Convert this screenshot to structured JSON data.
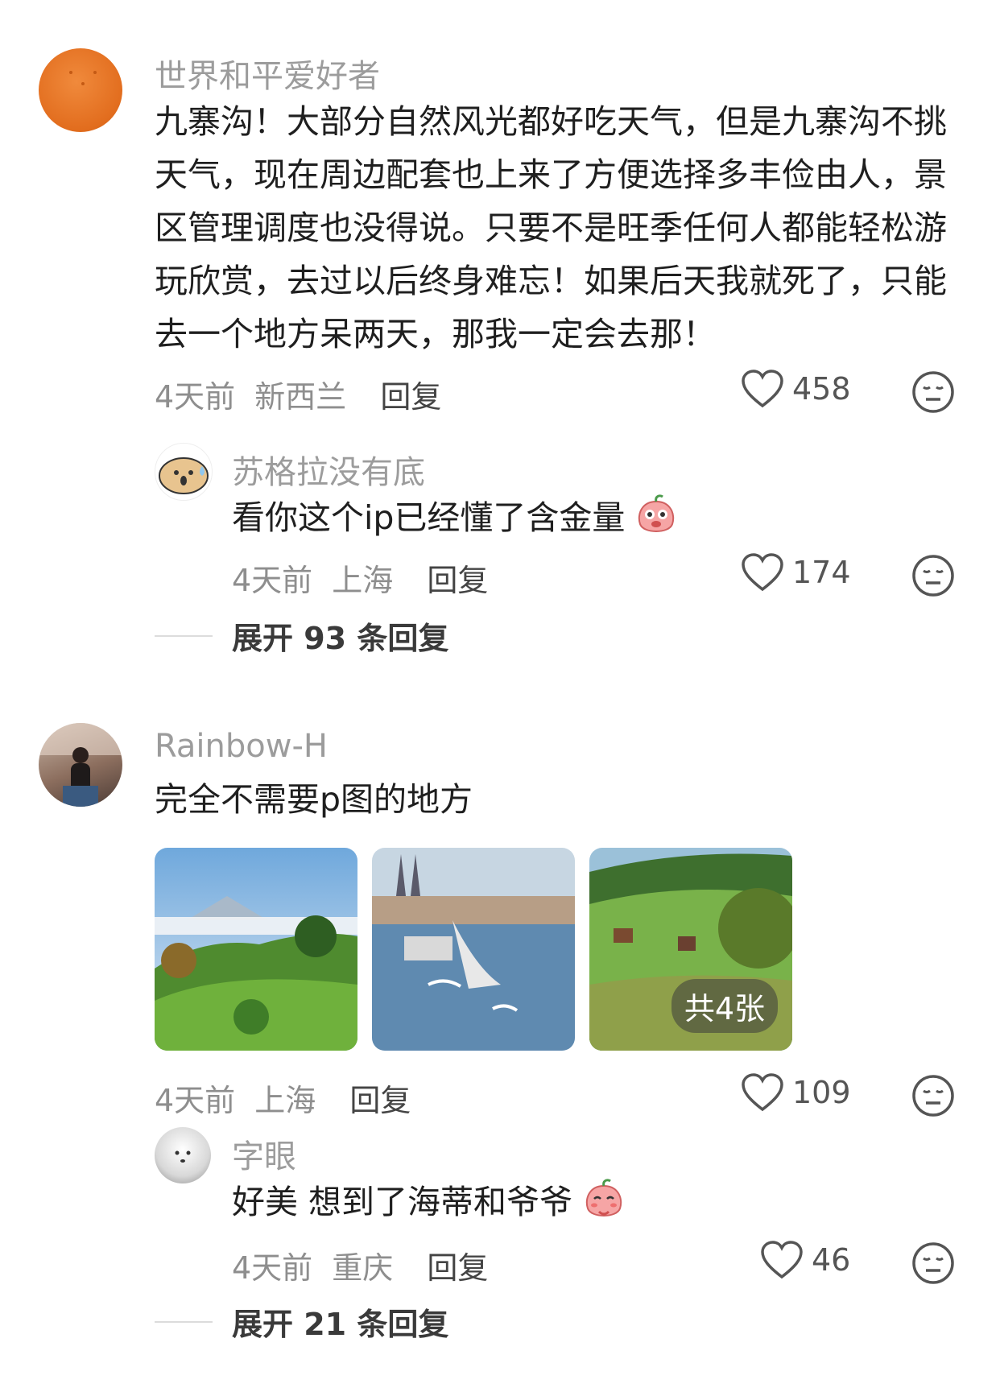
{
  "comments": [
    {
      "username": "世界和平爱好者",
      "text": "九寨沟！大部分自然风光都好吃天气，但是九寨沟不挑天气，现在周边配套也上来了方便选择多丰俭由人，景区管理调度也没得说。只要不是旺季任何人都能轻松游玩欣赏，去过以后终身难忘！如果后天我就死了，只能去一个地方呆两天，那我一定会去那！",
      "time": "4天前",
      "location": "新西兰",
      "reply_label": "回复",
      "likes": "458",
      "replies": [
        {
          "username": "苏格拉没有底",
          "text": "看你这个ip已经懂了含金量",
          "time": "4天前",
          "location": "上海",
          "reply_label": "回复",
          "likes": "174"
        }
      ],
      "expand_label": "展开 93 条回复"
    },
    {
      "username": "Rainbow-H",
      "text": "完全不需要p图的地方",
      "images_badge": "共4张",
      "time": "4天前",
      "location": "上海",
      "reply_label": "回复",
      "likes": "109",
      "replies": [
        {
          "username": "字眼",
          "text": "好美 想到了海蒂和爷爷",
          "time": "4天前",
          "location": "重庆",
          "reply_label": "回复",
          "likes": "46"
        }
      ],
      "expand_label": "展开 21 条回复"
    }
  ],
  "icons": {
    "like": "heart-outline-icon",
    "react": "neutral-face-icon",
    "sticker": "peach-sticker-icon"
  },
  "colors": {
    "username": "#9c9c9c",
    "body_text": "#1f1f1f",
    "meta": "#8e8e8e",
    "avatar1": "#e9782a"
  }
}
